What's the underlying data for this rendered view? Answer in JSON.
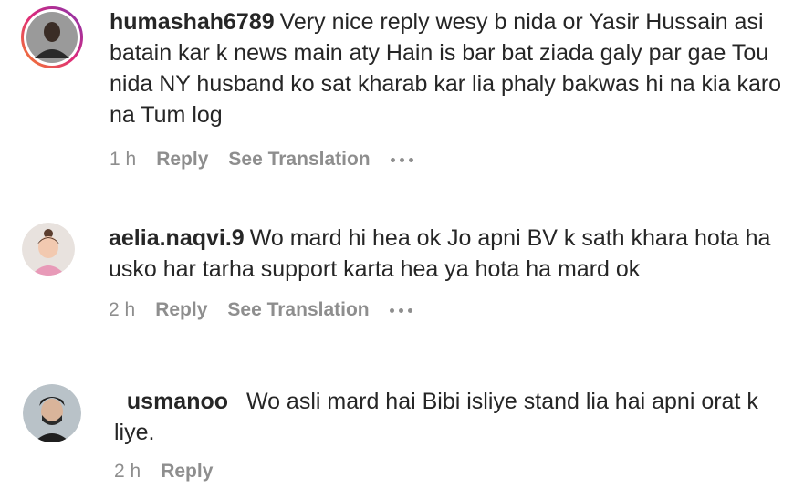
{
  "comments": [
    {
      "username": "humashah6789",
      "text": "Very nice reply wesy b nida or Yasir Hussain asi batain kar k news main aty Hain is bar bat ziada galy par gae Tou nida NY husband ko sat kharab kar lia phaly bakwas hi na kia karo na Tum log",
      "time": "1 h",
      "reply": "Reply",
      "translate": "See Translation"
    },
    {
      "username": "aelia.naqvi.9",
      "text": "Wo mard hi hea ok Jo apni BV k sath khara hota ha usko har tarha support karta hea ya hota ha mard ok",
      "time": "2 h",
      "reply": "Reply",
      "translate": "See Translation"
    },
    {
      "username": "_usmanoo_",
      "text": "Wo asli mard hai Bibi isliye stand lia hai apni orat k liye.",
      "time": "2 h",
      "reply": "Reply"
    }
  ],
  "colors": {
    "text": "#262626",
    "meta": "#8e8e8e",
    "story_ring_start": "#f58529",
    "story_ring_end": "#dd2a7b"
  },
  "icons": [
    "more-options-icon"
  ]
}
